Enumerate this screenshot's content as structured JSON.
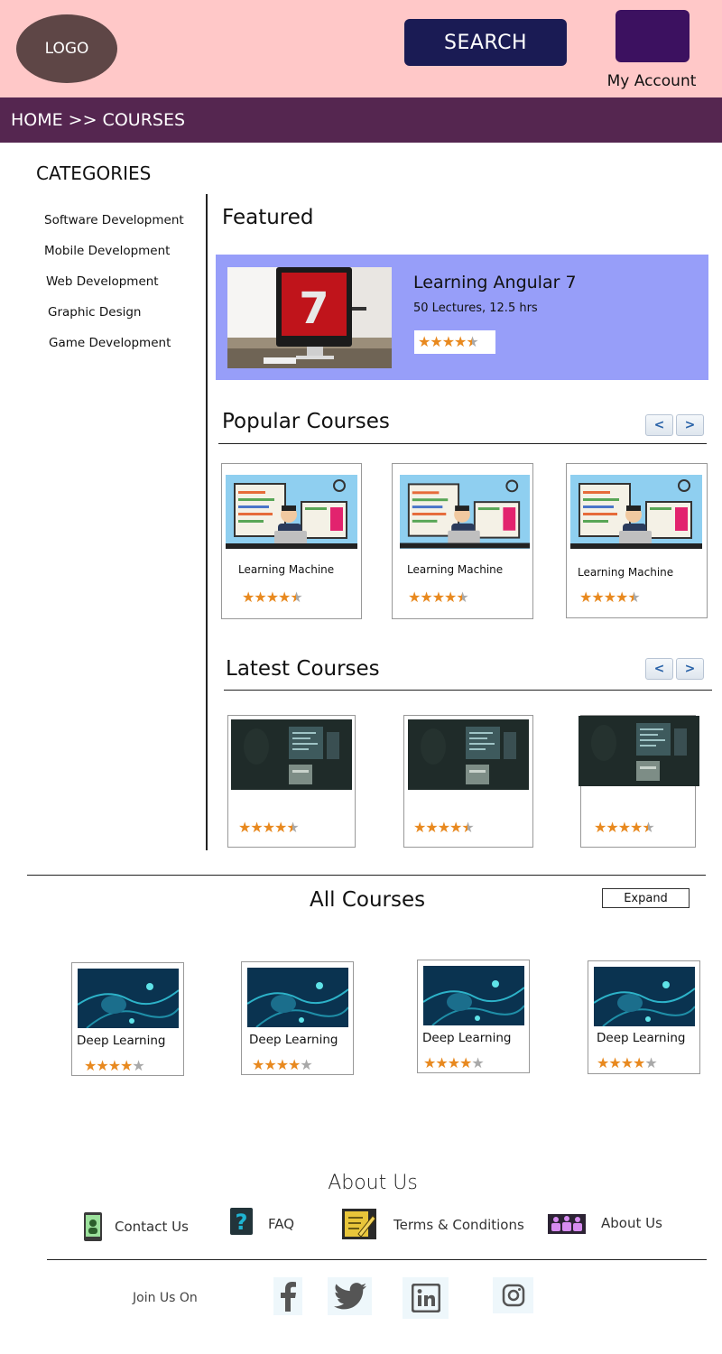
{
  "header": {
    "logo_text": "LOGO",
    "search_label": "SEARCH",
    "account_label": "My Account"
  },
  "breadcrumb": "HOME >> COURSES",
  "sidebar": {
    "title": "CATEGORIES",
    "items": [
      "Software Development",
      "Mobile Development",
      "Web Development",
      "Graphic Design",
      "Game Development"
    ]
  },
  "featured": {
    "heading": "Featured",
    "course": {
      "title": "Learning Angular 7",
      "meta": "50 Lectures, 12.5 hrs",
      "rating": 4.5,
      "image_badge": "7"
    }
  },
  "popular": {
    "heading": "Popular Courses",
    "prev": "<",
    "next": ">",
    "courses": [
      {
        "title": "Learning Machine",
        "rating": 4.5
      },
      {
        "title": "Learning Machine",
        "rating": 4.5
      },
      {
        "title": "Learning Machine",
        "rating": 4.5
      }
    ]
  },
  "latest": {
    "heading": "Latest Courses",
    "prev": "<",
    "next": ">",
    "courses": [
      {
        "rating": 4.5
      },
      {
        "rating": 4.5
      },
      {
        "rating": 4.5
      }
    ]
  },
  "all_courses": {
    "heading": "All Courses",
    "expand_label": "Expand",
    "courses": [
      {
        "title": "Deep Learning",
        "rating": 4
      },
      {
        "title": "Deep Learning",
        "rating": 4
      },
      {
        "title": "Deep Learning",
        "rating": 4
      },
      {
        "title": "Deep Learning",
        "rating": 4
      }
    ]
  },
  "footer": {
    "heading": "About Us",
    "links": [
      {
        "label": "Contact Us",
        "icon": "contact-icon"
      },
      {
        "label": "FAQ",
        "icon": "question-icon"
      },
      {
        "label": "Terms & Conditions",
        "icon": "edit-document-icon"
      },
      {
        "label": "About Us",
        "icon": "team-icon"
      }
    ],
    "join_label": "Join Us On",
    "social": [
      "facebook-icon",
      "twitter-icon",
      "linkedin-icon",
      "instagram-icon"
    ]
  },
  "colors": {
    "header_bg": "#ffc8c8",
    "breadcrumb_bg": "#552650",
    "search_bg": "#1a1b54",
    "featured_bg": "#979ef9",
    "star": "#e8891f",
    "star_empty": "#a9a9a9"
  }
}
